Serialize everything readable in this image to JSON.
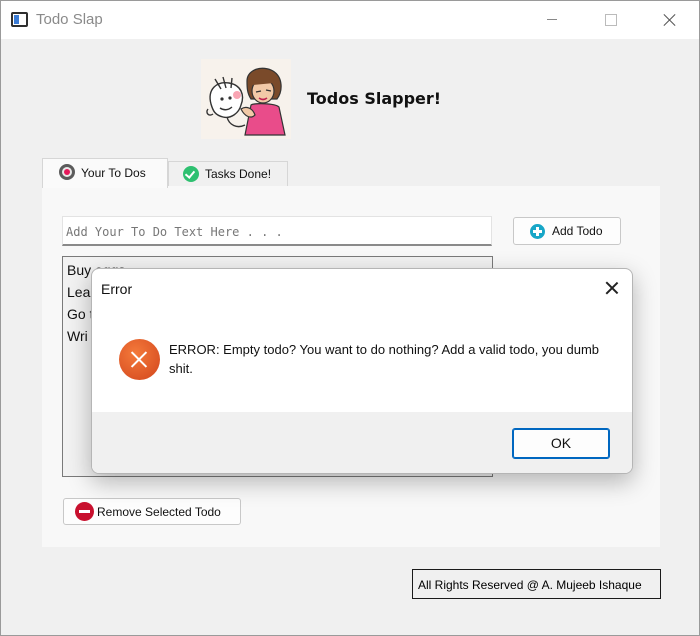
{
  "window": {
    "title": "Todo Slap"
  },
  "header": {
    "title": "Todos Slapper!"
  },
  "tabs": [
    {
      "label": "Your To Dos",
      "icon": "record-icon"
    },
    {
      "label": "Tasks Done!",
      "icon": "check-circle-icon"
    }
  ],
  "todo_input": {
    "placeholder": "Add Your To Do Text Here . . .",
    "value": ""
  },
  "add_button": {
    "label": "Add Todo",
    "icon": "add-circle-icon"
  },
  "todo_list": {
    "items": [
      "Buy eggs",
      "Lea",
      "Go t",
      "Wri"
    ]
  },
  "remove_button": {
    "label": "Remove Selected Todo",
    "icon": "remove-circle-icon"
  },
  "footer": {
    "text": "All Rights Reserved @ A. Mujeeb Ishaque"
  },
  "dialog": {
    "title": "Error",
    "message": "ERROR: Empty todo? You want to do nothing? Add a valid todo, you dumb shit.",
    "ok_label": "OK",
    "icon": "error-icon"
  },
  "colors": {
    "accent": "#0067c0",
    "error": "#d2451c",
    "add": "#17a6c7",
    "remove": "#c8102e",
    "done": "#2ec070"
  }
}
